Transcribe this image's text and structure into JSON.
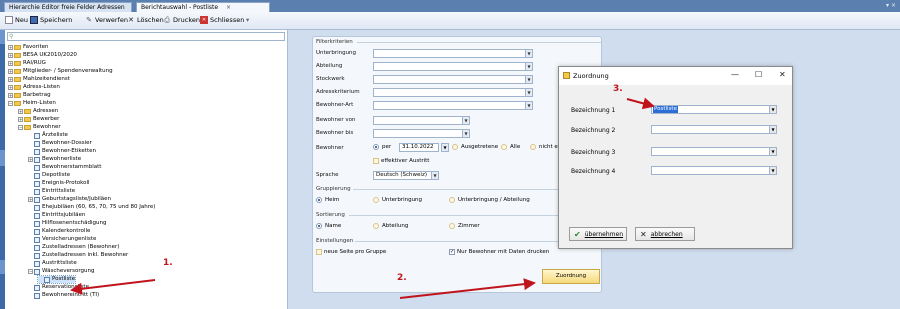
{
  "tabs": [
    {
      "label": "Hierarchie Editor freie Felder Adressen"
    },
    {
      "label": "Berichtauswahl - Postliste"
    }
  ],
  "tab_close": "×",
  "tabbar_close": "▾ ×",
  "toolbar": {
    "neu": "Neu",
    "speichern": "Speichern",
    "verwerfen": "Verwerfen",
    "loeschen": "Löschen",
    "drucken": "Drucken",
    "schliessen": "Schliessen"
  },
  "tree": [
    {
      "label": "Favoriten",
      "type": "folder",
      "exp": "+"
    },
    {
      "label": "BESA UK2010/2020",
      "type": "folder",
      "exp": "+"
    },
    {
      "label": "RAI/RUG",
      "type": "folder",
      "exp": "+"
    },
    {
      "label": "Mitglieder- / Spendenverwaltung",
      "type": "folder",
      "exp": "+"
    },
    {
      "label": "Mahlzeitendienst",
      "type": "folder",
      "exp": "+"
    },
    {
      "label": "Adress-Listen",
      "type": "folder",
      "exp": "+"
    },
    {
      "label": "Barbetrag",
      "type": "folder",
      "exp": "+"
    },
    {
      "label": "Heim-Listen",
      "type": "folder",
      "exp": "−"
    },
    {
      "label": "Adressen",
      "type": "folder",
      "exp": "+"
    },
    {
      "label": "Bewerber",
      "type": "folder",
      "exp": "+"
    },
    {
      "label": "Bewohner",
      "type": "folder",
      "exp": "−"
    },
    {
      "label": "Ärzteliste",
      "type": "report"
    },
    {
      "label": "Bewohner-Dossier",
      "type": "report"
    },
    {
      "label": "Bewohner-Etiketten",
      "type": "report"
    },
    {
      "label": "Bewohnerliste",
      "type": "report",
      "exp": "+"
    },
    {
      "label": "Bewohnerstammblatt",
      "type": "report"
    },
    {
      "label": "Depotliste",
      "type": "report"
    },
    {
      "label": "Ereignis-Protokoll",
      "type": "report"
    },
    {
      "label": "Eintrittsliste",
      "type": "report"
    },
    {
      "label": "Geburtstagsliste/Jubiläen",
      "type": "report",
      "exp": "+"
    },
    {
      "label": "Ehejubiläen (60, 65, 70, 75 und 80 Jahre)",
      "type": "report"
    },
    {
      "label": "Eintrittsjubiläen",
      "type": "report"
    },
    {
      "label": "Hilflosenentschädigung",
      "type": "report"
    },
    {
      "label": "Kalenderkontrolle",
      "type": "report"
    },
    {
      "label": "Versicherungenliste",
      "type": "report"
    },
    {
      "label": "Zustelladressen (Bewohner)",
      "type": "report"
    },
    {
      "label": "Zustelladressen inkl. Bewohner",
      "type": "report"
    },
    {
      "label": "Austrittsliste",
      "type": "report"
    },
    {
      "label": "Wäscheversorgung",
      "type": "report",
      "exp": "−"
    },
    {
      "label": "Postliste",
      "type": "report",
      "selected": true
    },
    {
      "label": "Reservationsliste",
      "type": "report"
    },
    {
      "label": "Bewohnereintritt (TI)",
      "type": "report"
    }
  ],
  "form": {
    "filterkriterien": "Filterkriterien",
    "unterbringung": "Unterbringung",
    "abteilung": "Abteilung",
    "stockwerk": "Stockwerk",
    "adresskriterium": "Adresskriterium",
    "bewohnerart": "Bewohner-Art",
    "bewohner_von": "Bewohner von",
    "bewohner_bis": "Bewohner bis",
    "bewohner": "Bewohner",
    "per": "per",
    "per_date": "31.10.2022",
    "ausgetretene": "Ausgetretene",
    "alle": "Alle",
    "nicht_ein": "nicht ein",
    "effektiver_austritt": "effektiver Austritt",
    "sprache": "Sprache",
    "sprache_val": "Deutsch (Schweiz)",
    "gruppierung": "Gruppierung",
    "g_heim": "Heim",
    "g_unterbringung": "Unterbringung",
    "g_unterbringung_abteilung": "Unterbringung / Abteilung",
    "sortierung": "Sortierung",
    "s_name": "Name",
    "s_abteilung": "Abteilung",
    "s_zimmer": "Zimmer",
    "einstellungen": "Einstellungen",
    "neue_seite": "neue Seite pro Gruppe",
    "nur_bewohner": "Nur Bewohner mit Daten drucken",
    "zuordnung_btn": "Zuordnung"
  },
  "dialog": {
    "title": "Zuordnung",
    "minimize": "—",
    "maximize": "☐",
    "close": "✕",
    "rows": [
      {
        "label": "Bezeichnung 1",
        "value": "Postliste"
      },
      {
        "label": "Bezeichnung 2",
        "value": ""
      },
      {
        "label": "Bezeichnung 3",
        "value": ""
      },
      {
        "label": "Bezeichnung 4",
        "value": ""
      }
    ],
    "uebernehmen": "übernehmen",
    "abbrechen": "abbrechen"
  },
  "annotations": {
    "one": "1.",
    "two": "2.",
    "three": "3."
  },
  "colors": {
    "arrow": "#c0141c",
    "accent": "#3c6aa8",
    "highlight": "#2c6ed6"
  }
}
